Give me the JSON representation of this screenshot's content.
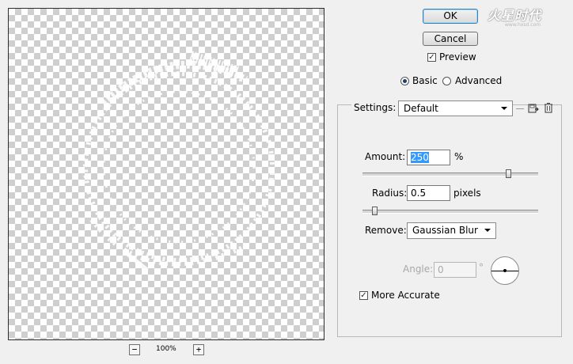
{
  "preview": {
    "zoom_out": "−",
    "zoom_in": "+",
    "zoom_level": "100%"
  },
  "buttons": {
    "ok": "OK",
    "cancel": "Cancel"
  },
  "preview_toggle": {
    "label": "Preview",
    "checked": true
  },
  "mode": {
    "basic": "Basic",
    "advanced": "Advanced",
    "selected": "Basic"
  },
  "watermark": {
    "title": "火星时代",
    "site": "www.hxsd.com"
  },
  "settings": {
    "label": "Settings:",
    "value": "Default"
  },
  "amount": {
    "label": "Amount:",
    "value": "250",
    "unit": "%",
    "slider_fraction": 0.87
  },
  "radius": {
    "label": "Radius:",
    "value": "0.5",
    "unit": "pixels",
    "slider_fraction": 0.02
  },
  "remove": {
    "label": "Remove:",
    "value": "Gaussian Blur"
  },
  "angle": {
    "label": "Angle:",
    "value": "0",
    "unit": "°"
  },
  "more_accurate": {
    "label": "More Accurate",
    "checked": true
  }
}
